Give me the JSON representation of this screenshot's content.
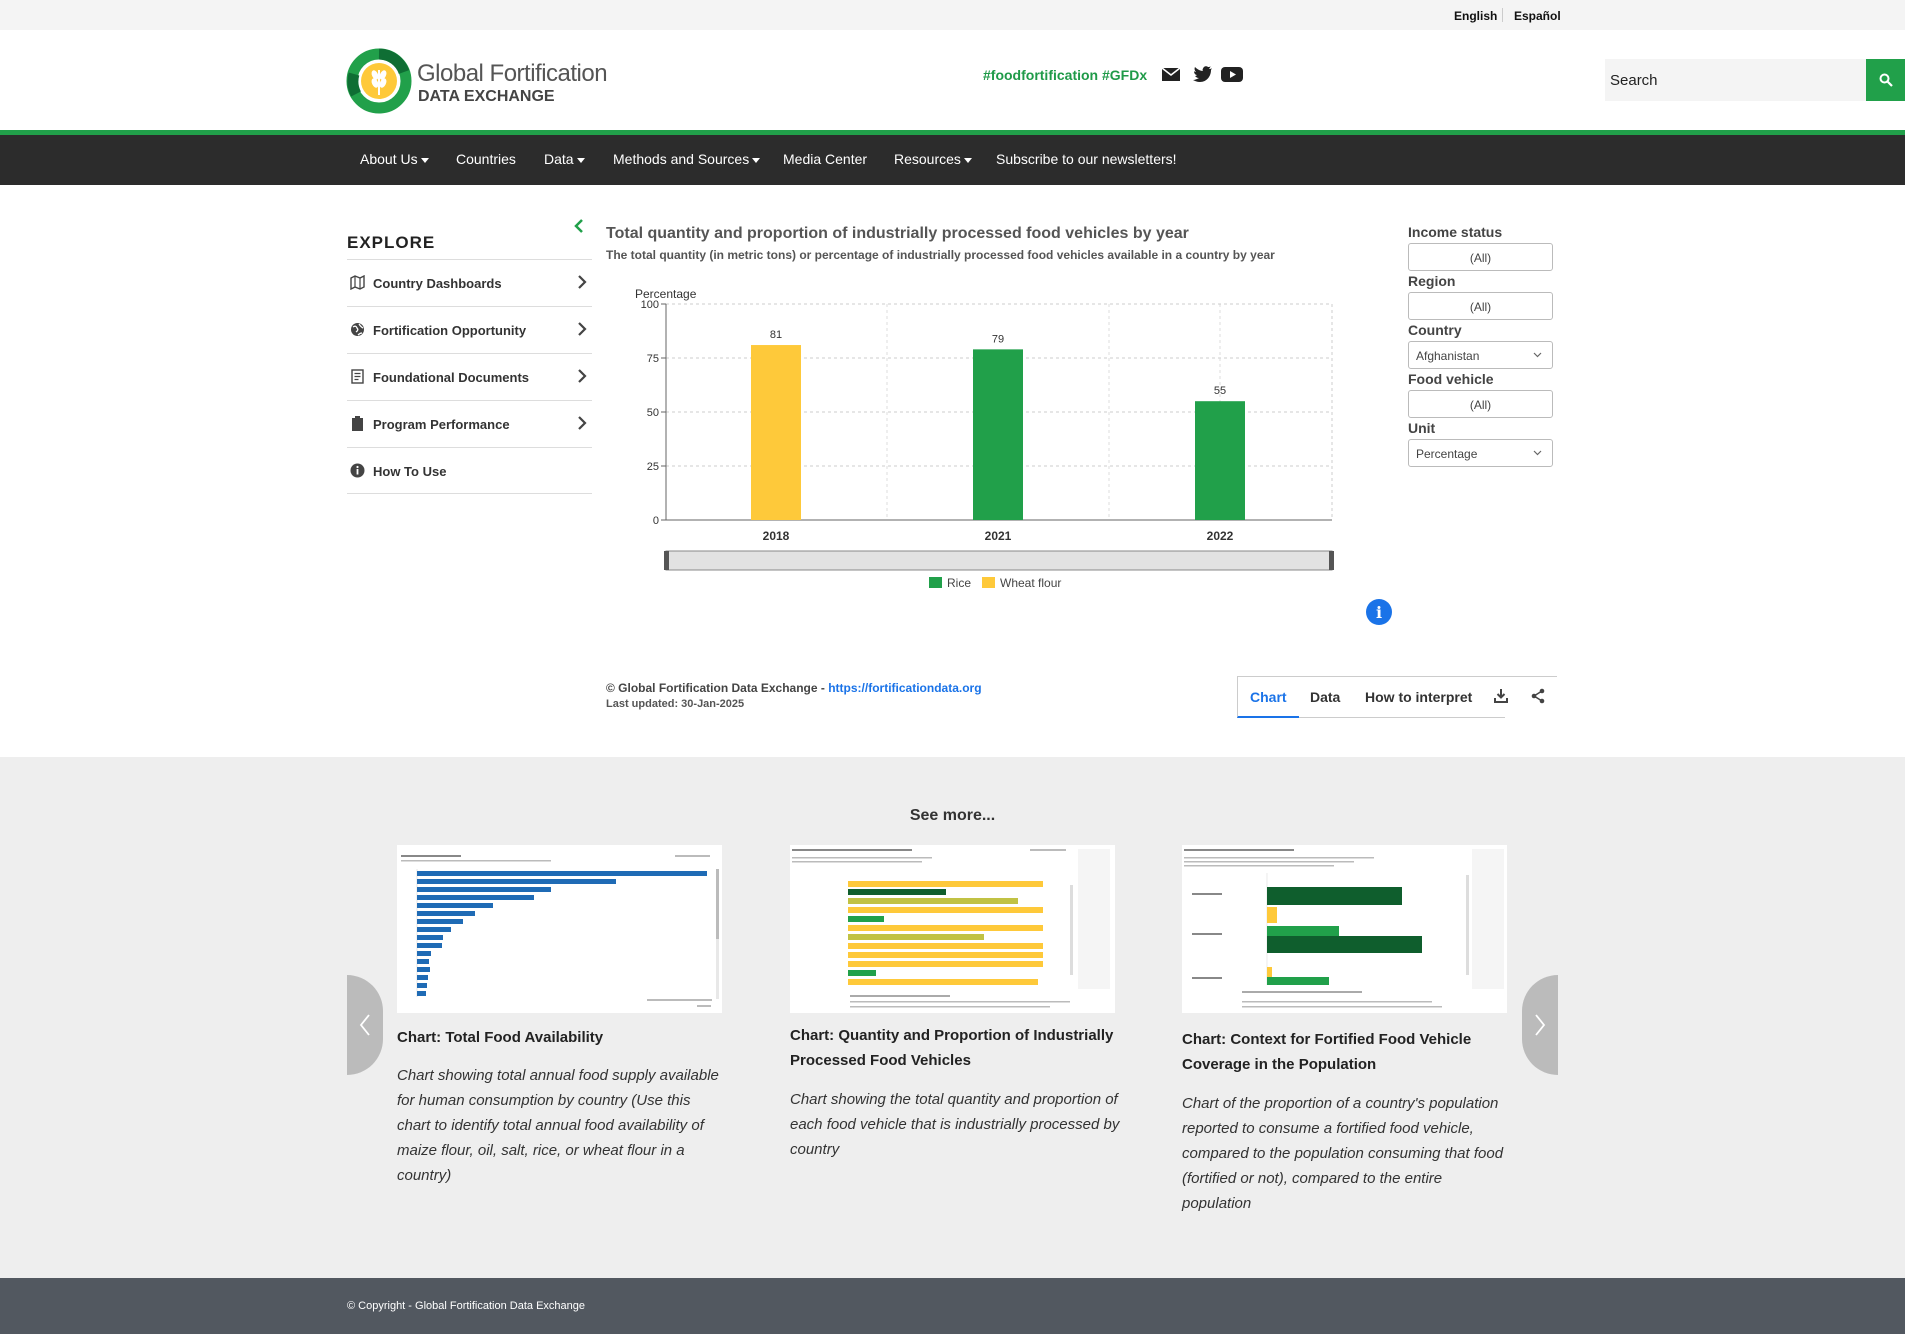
{
  "lang": {
    "english": "English",
    "espanol": "Español"
  },
  "header": {
    "logo_line1": "Global Fortification",
    "logo_line2": "DATA EXCHANGE",
    "hashtags": "#foodfortification #GFDx",
    "search_placeholder": "Search",
    "colors": {
      "brand_green": "#21a04a",
      "dark_nav": "#2c2c2c"
    }
  },
  "nav": {
    "items": [
      {
        "label": "About Us",
        "dropdown": true
      },
      {
        "label": "Countries",
        "dropdown": false
      },
      {
        "label": "Data",
        "dropdown": true
      },
      {
        "label": "Methods and Sources",
        "dropdown": true
      },
      {
        "label": "Media Center",
        "dropdown": false
      },
      {
        "label": "Resources",
        "dropdown": true
      },
      {
        "label": "Subscribe to our newsletters!",
        "dropdown": false
      }
    ]
  },
  "sidebar": {
    "title": "EXPLORE",
    "items": [
      {
        "label": "Country Dashboards",
        "icon": "map-icon",
        "chevron": true
      },
      {
        "label": "Fortification Opportunity",
        "icon": "globe-icon",
        "chevron": true
      },
      {
        "label": "Foundational Documents",
        "icon": "document-icon",
        "chevron": true
      },
      {
        "label": "Program Performance",
        "icon": "clipboard-icon",
        "chevron": true
      },
      {
        "label": "How To Use",
        "icon": "info-icon",
        "chevron": false
      }
    ]
  },
  "chart_title": "Total quantity and proportion of industrially processed food vehicles by year",
  "chart_subtitle": "The total quantity (in metric tons) or percentage of industrially processed food vehicles available in a country by year",
  "chart_data": {
    "type": "bar",
    "categories": [
      "2018",
      "2021",
      "2022"
    ],
    "ylabel": "Percentage",
    "xlabel": "",
    "ylim": [
      0,
      100
    ],
    "yticks": [
      0,
      25,
      50,
      75,
      100
    ],
    "series": [
      {
        "name": "Wheat flour",
        "color": "#fec93a",
        "values": [
          81,
          null,
          null
        ]
      },
      {
        "name": "Rice",
        "color": "#21a04a",
        "values": [
          null,
          79,
          55
        ]
      }
    ],
    "legend_order": [
      "Rice",
      "Wheat flour"
    ],
    "legend_position": "bottom",
    "grid": true
  },
  "filters": [
    {
      "label": "Income status",
      "value": "(All)",
      "type": "multi"
    },
    {
      "label": "Region",
      "value": "(All)",
      "type": "multi"
    },
    {
      "label": "Country",
      "value": "Afghanistan",
      "type": "select"
    },
    {
      "label": "Food vehicle",
      "value": "(All)",
      "type": "multi"
    },
    {
      "label": "Unit",
      "value": "Percentage",
      "type": "select"
    }
  ],
  "source": {
    "text": "© Global Fortification Data Exchange - ",
    "link": "https://fortificationdata.org",
    "updated": "Last updated: 30-Jan-2025"
  },
  "tabs": {
    "chart": "Chart",
    "data": "Data",
    "interpret": "How to interpret"
  },
  "see_more": {
    "title": "See more...",
    "cards": [
      {
        "title": "Chart: Total Food Availability",
        "description": "Chart showing total annual food supply available for human consumption by country (Use this chart to identify total annual food availability of maize flour, oil, salt, rice, or wheat flour in a country)"
      },
      {
        "title": "Chart: Quantity and Proportion of Industrially Processed Food Vehicles",
        "description": "Chart showing the total quantity and proportion of each food vehicle that is industrially processed by country"
      },
      {
        "title": "Chart: Context for Fortified Food Vehicle Coverage in the Population",
        "description": "Chart of the proportion of a country's population reported to consume a fortified food vehicle, compared to the population consuming that food (fortified or not), compared to the entire population"
      }
    ]
  },
  "footer": {
    "copyright": "© Copyright - Global Fortification Data Exchange"
  }
}
